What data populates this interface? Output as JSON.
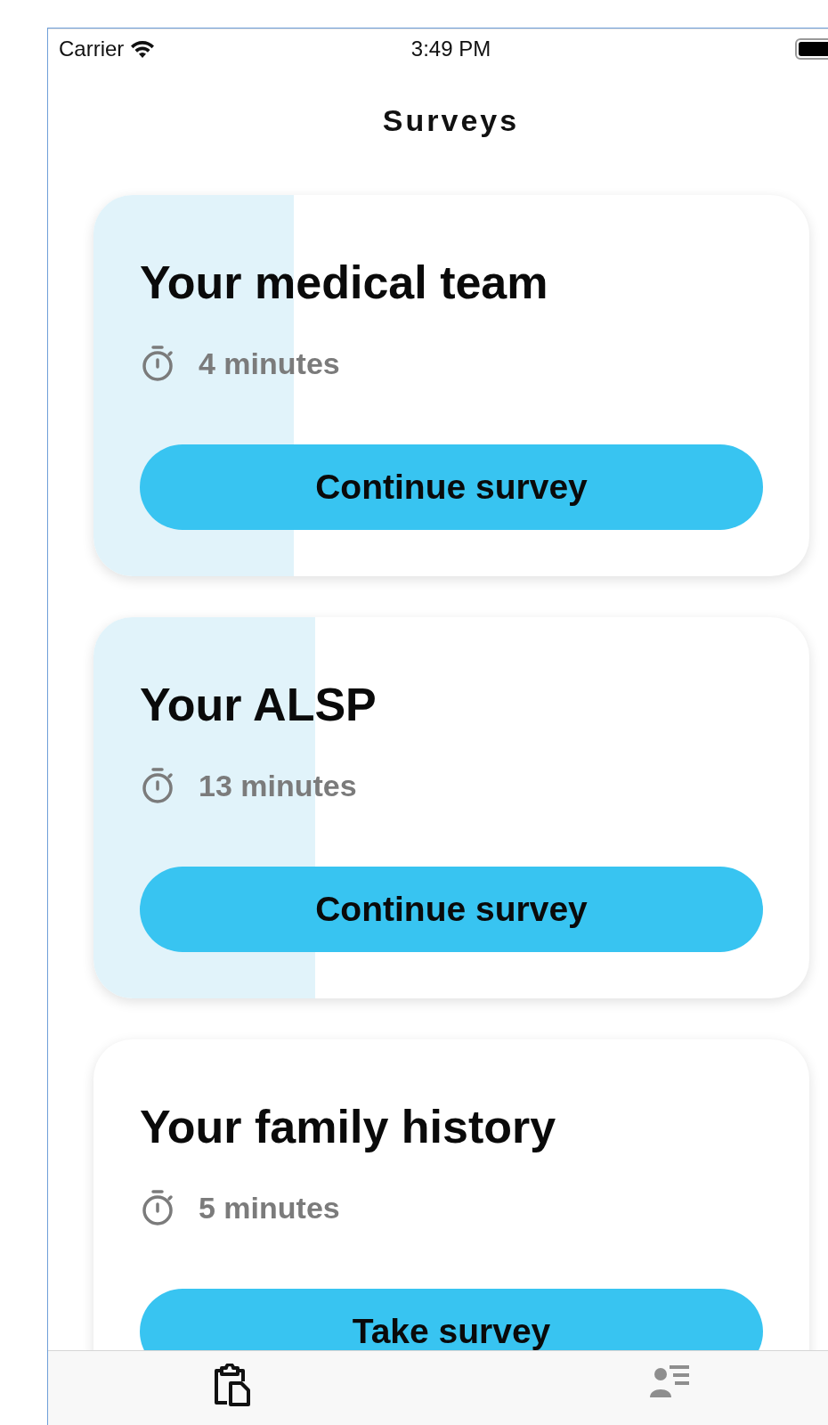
{
  "status_bar": {
    "carrier": "Carrier",
    "time": "3:49 PM"
  },
  "header": {
    "title": "Surveys"
  },
  "surveys": [
    {
      "title": "Your medical team",
      "duration": "4 minutes",
      "level": 0.28,
      "action": "Continue survey"
    },
    {
      "title": "Your ALSP",
      "duration": "13 minutes",
      "level": 0.31,
      "action": "Continue survey"
    },
    {
      "title": "Your family history",
      "duration": "5 minutes",
      "action": "Take survey"
    }
  ],
  "tab_bar": [
    {
      "kind": "surveys",
      "selected": true
    },
    {
      "kind": "profile",
      "selected": false
    }
  ]
}
